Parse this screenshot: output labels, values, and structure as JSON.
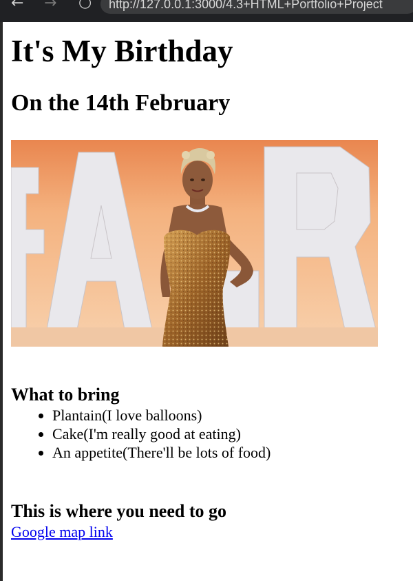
{
  "browser": {
    "back_icon": "←",
    "forward_icon": "→",
    "reload_icon": "○",
    "url": "http://127.0.0.1:3000/4.3+HTML+Portfolio+Project"
  },
  "page": {
    "title": "It's My Birthday",
    "subtitle": "On the 14th February",
    "bring_heading": "What to bring",
    "bring_items": [
      "Plantain(I love balloons)",
      "Cake(I'm really good at eating)",
      "An appetite(There'll be lots of food)"
    ],
    "go_heading": "This is where you need to go",
    "map_link_text": "Google map link"
  },
  "colors": {
    "link": "#0000ee",
    "photo_background": "#f3c49c",
    "photo_letters": "#e9e8ec",
    "photo_accent": "#e9864f",
    "dress": "#b47a35"
  }
}
